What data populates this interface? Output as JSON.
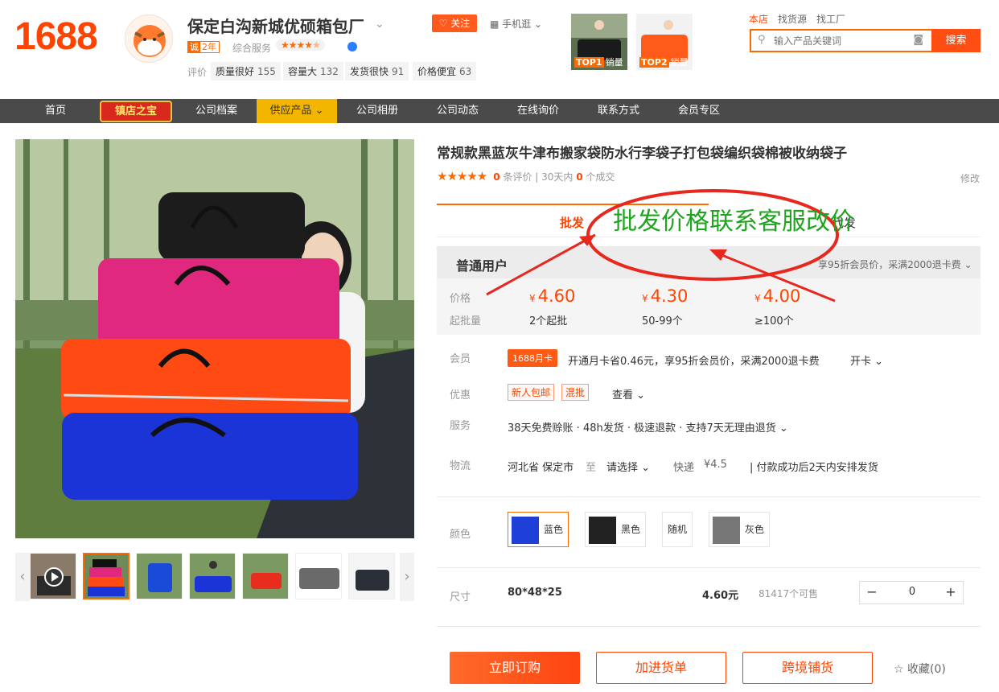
{
  "header": {
    "logo": "1688",
    "company_name": "保定白沟新城优硕箱包厂",
    "cheng_badge_prefix": "诚",
    "cheng_badge_years": "2年",
    "service_label": "综合服务",
    "service_rating": 4.5,
    "eval_label": "评价",
    "tags": [
      {
        "label": "质量很好",
        "count": "155"
      },
      {
        "label": "容量大",
        "count": "132"
      },
      {
        "label": "发货很快",
        "count": "91"
      },
      {
        "label": "价格便宜",
        "count": "63"
      }
    ],
    "follow_label": "关注",
    "mobile_label": "手机逛",
    "top_items": [
      {
        "rank": "TOP1",
        "label": "销量"
      },
      {
        "rank": "TOP2",
        "label": "销量"
      }
    ],
    "search_scopes": [
      "本店",
      "找货源",
      "找工厂"
    ],
    "search_placeholder": "输入产品关键词",
    "search_button": "搜索"
  },
  "nav": {
    "items": [
      "首页",
      "镇店之宝",
      "公司档案",
      "供应产品",
      "公司相册",
      "公司动态",
      "在线询价",
      "联系方式",
      "会员专区"
    ],
    "active_index": 3
  },
  "product": {
    "title": "常规款黑蓝灰牛津布搬家袋防水行李袋子打包袋编织袋棉被收纳袋子",
    "review_count": "0",
    "review_label": "条评价",
    "deals_prefix": "30天内",
    "deals_count": "0",
    "deals_label": "个成交",
    "modify_label": "修改",
    "tab_wholesale": "批发",
    "tab_dropship": "代发",
    "overlay_note": "批发价格联系客服改价",
    "user_type": "普通用户",
    "vip_note": "享95折会员价，采满2000退卡费",
    "price_label": "价格",
    "moq_label": "起批量",
    "currency": "¥",
    "tiers": [
      {
        "price": "4.60",
        "moq": "2个起批"
      },
      {
        "price": "4.30",
        "moq": "50-99个"
      },
      {
        "price": "4.00",
        "moq": "≥100个"
      }
    ],
    "member_label": "会员",
    "member_badge": "1688月卡",
    "member_text": "开通月卡省0.46元，享95折会员价，采满2000退卡费",
    "member_action": "开卡",
    "promo_label": "优惠",
    "promo_tags": [
      "新人包邮",
      "混批"
    ],
    "promo_action": "查看",
    "service_label": "服务",
    "service_text": "38天免费赊账 · 48h发货 · 极速退款 · 支持7天无理由退货",
    "logistics_label": "物流",
    "logistics_from": "河北省 保定市",
    "logistics_to_label": "至",
    "logistics_to": "请选择",
    "logistics_method": "快递",
    "logistics_fee": "¥4.5",
    "logistics_note": "付款成功后2天内安排发货",
    "color_label": "颜色",
    "colors": [
      {
        "name": "蓝色",
        "swatch": "#1e40d8"
      },
      {
        "name": "黑色",
        "swatch": "#222222"
      },
      {
        "name": "随机",
        "swatch": ""
      },
      {
        "name": "灰色",
        "swatch": "#777777"
      }
    ],
    "size_label": "尺寸",
    "size_value": "80*48*25",
    "size_price": "4.60元",
    "stock": "81417个可售",
    "quantity": "0",
    "buy_now": "立即订购",
    "add_cart": "加进货单",
    "cross_border": "跨境铺货",
    "favorite": "收藏(0)"
  },
  "colors": {
    "accent": "#ff4400",
    "nav_bg": "#4a4a4a",
    "nav_active": "#f2b600",
    "overlay": "#1ea51e",
    "overlay_ring": "#e8281e"
  }
}
